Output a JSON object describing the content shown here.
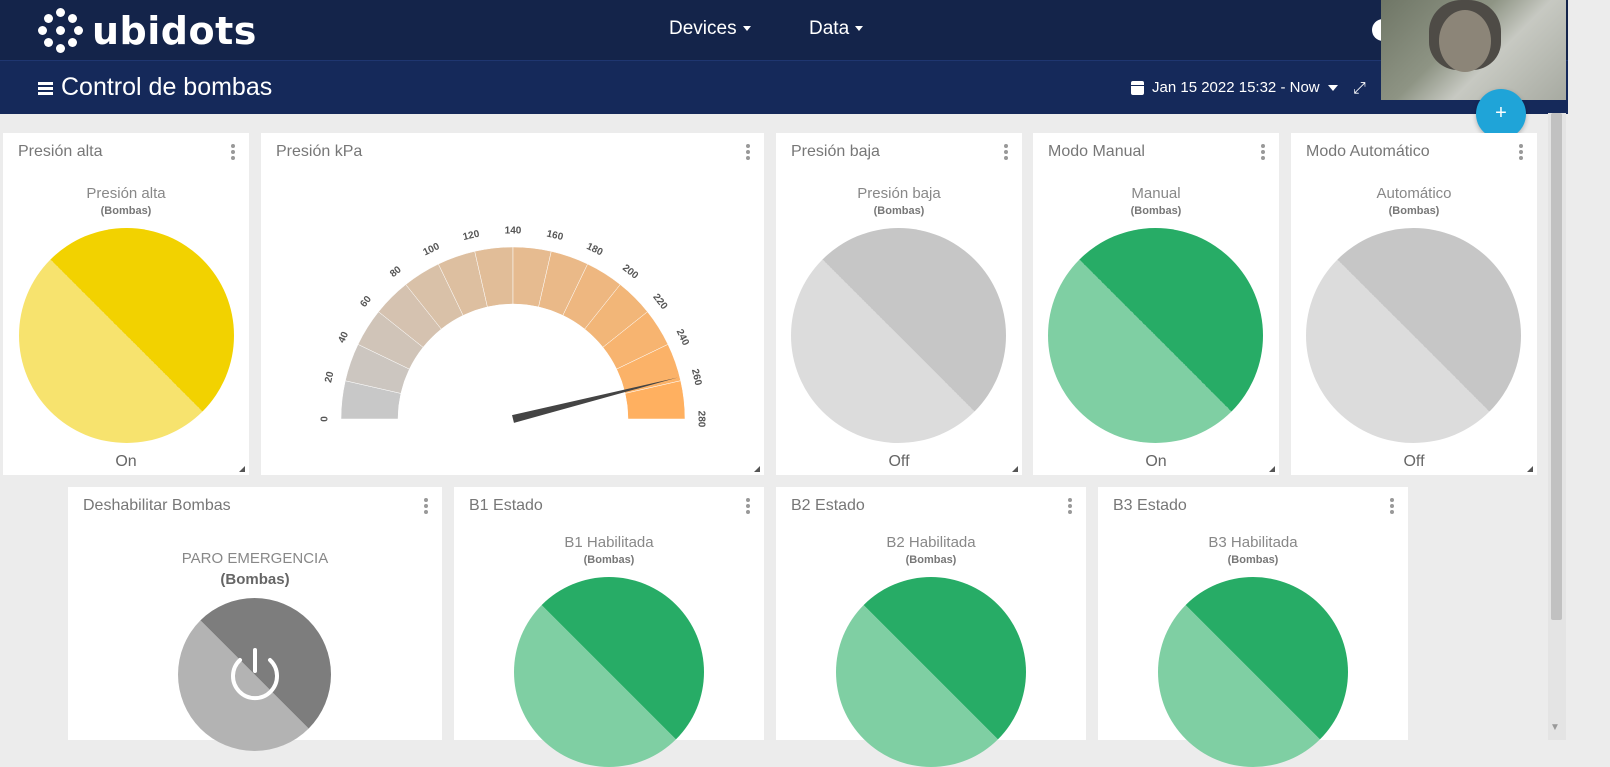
{
  "app": {
    "logo_text": "ubidots",
    "nav": [
      {
        "label": "Devices"
      },
      {
        "label": "Data"
      }
    ]
  },
  "dashboard": {
    "title": "Control de bombas",
    "date_range": "Jan 15 2022 15:32 - Now",
    "add_button": "+"
  },
  "widgets": [
    {
      "title": "Presión alta",
      "variable": "Presión alta",
      "device": "(Bombas)",
      "state": "On",
      "color_dark": "#f2d200",
      "color_light": "#f7e36e"
    },
    {
      "title": "Presión kPa",
      "type": "gauge",
      "value": 258,
      "min": 0,
      "max": 280,
      "ticks": [
        "0",
        "20",
        "40",
        "60",
        "80",
        "100",
        "120",
        "140",
        "160",
        "180",
        "200",
        "220",
        "240",
        "260",
        "280"
      ],
      "color_start": "#c8c8c8",
      "color_end": "#ffb060"
    },
    {
      "title": "Presión baja",
      "variable": "Presión baja",
      "device": "(Bombas)",
      "state": "Off",
      "color_dark": "#c6c6c6",
      "color_light": "#dcdcdc"
    },
    {
      "title": "Modo Manual",
      "variable": "Manual",
      "device": "(Bombas)",
      "state": "On",
      "color_dark": "#27ac66",
      "color_light": "#7fcfa3"
    },
    {
      "title": "Modo Automático",
      "variable": "Automático",
      "device": "(Bombas)",
      "state": "Off",
      "color_dark": "#c6c6c6",
      "color_light": "#dcdcdc"
    },
    {
      "title": "Deshabilitar Bombas",
      "variable": "PARO EMERGENCIA",
      "device": "(Bombas)",
      "type": "switch",
      "color_dark": "#7d7d7d",
      "color_light": "#b3b3b3"
    },
    {
      "title": "B1 Estado",
      "variable": "B1 Habilitada",
      "device": "(Bombas)",
      "color_dark": "#27ac66",
      "color_light": "#7fcfa3"
    },
    {
      "title": "B2 Estado",
      "variable": "B2 Habilitada",
      "device": "(Bombas)",
      "color_dark": "#27ac66",
      "color_light": "#7fcfa3"
    },
    {
      "title": "B3 Estado",
      "variable": "B3 Habilitada",
      "device": "(Bombas)",
      "color_dark": "#27ac66",
      "color_light": "#7fcfa3"
    }
  ],
  "icons": {
    "menu": "hamburger-icon",
    "calendar": "calendar-icon",
    "expand": "expand-icon",
    "widget_menu": "kebab-icon",
    "power": "power-icon",
    "help": "help-icon"
  }
}
